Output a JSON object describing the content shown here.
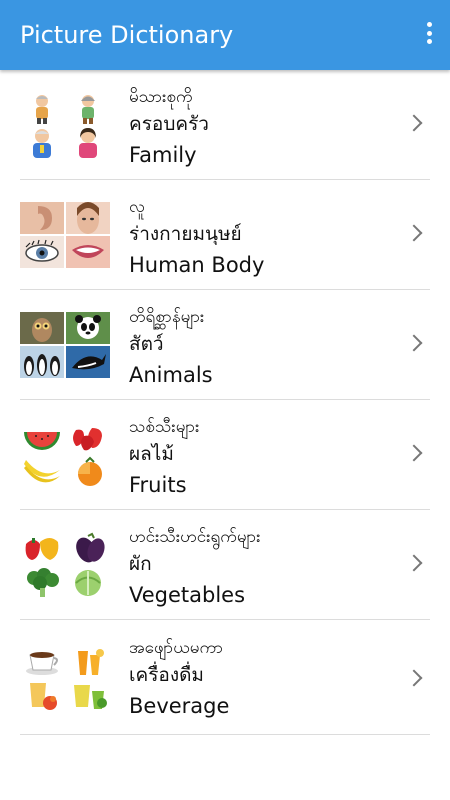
{
  "app": {
    "title": "Picture Dictionary",
    "menu_icon": "more-vert-icon"
  },
  "categories": [
    {
      "line1": "မိသားစုကို",
      "line2": "ครอบครัว",
      "line3": "Family",
      "thumb_icon": "family-thumbnail"
    },
    {
      "line1": "လူ",
      "line2": "ร่างกายมนุษย์",
      "line3": "Human Body",
      "thumb_icon": "human-body-thumbnail"
    },
    {
      "line1": "တိရိစ္ဆာန်များ",
      "line2": "สัตว์",
      "line3": "Animals",
      "thumb_icon": "animals-thumbnail"
    },
    {
      "line1": "သစ်သီးများ",
      "line2": "ผลไม้",
      "line3": "Fruits",
      "thumb_icon": "fruits-thumbnail"
    },
    {
      "line1": "ဟင်းသီးဟင်းရွက်များ",
      "line2": "ผัก",
      "line3": "Vegetables",
      "thumb_icon": "vegetables-thumbnail"
    },
    {
      "line1": "အဖျော်ယမကာ",
      "line2": "เครื่องดื่ม",
      "line3": "Beverage",
      "thumb_icon": "beverage-thumbnail"
    }
  ],
  "colors": {
    "appbar": "#3a96e2",
    "divider": "#dcdcdc",
    "chevron": "#777777"
  }
}
